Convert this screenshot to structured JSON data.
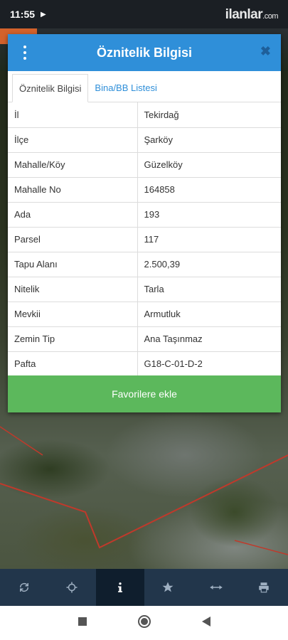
{
  "status": {
    "time": "11:55",
    "watermark": "ilanlar",
    "watermark_suffix": ".com"
  },
  "dialog": {
    "title": "Öznitelik Bilgisi",
    "tabs": [
      {
        "label": "Öznitelik Bilgisi"
      },
      {
        "label": "Bina/BB Listesi"
      }
    ],
    "rows": [
      {
        "key": "İl",
        "value": "Tekirdağ"
      },
      {
        "key": "İlçe",
        "value": "Şarköy"
      },
      {
        "key": "Mahalle/Köy",
        "value": "Güzelköy"
      },
      {
        "key": "Mahalle No",
        "value": "164858"
      },
      {
        "key": "Ada",
        "value": "193"
      },
      {
        "key": "Parsel",
        "value": "117"
      },
      {
        "key": "Tapu Alanı",
        "value": "2.500,39"
      },
      {
        "key": "Nitelik",
        "value": "Tarla"
      },
      {
        "key": "Mevkii",
        "value": "Armutluk"
      },
      {
        "key": "Zemin Tip",
        "value": "Ana Taşınmaz"
      },
      {
        "key": "Pafta",
        "value": "G18-C-01-D-2"
      }
    ],
    "favorite_label": "Favorilere ekle",
    "close_icon": "close-icon",
    "menu_icon": "more-vertical-icon"
  },
  "toolbar": {
    "items": [
      "refresh-icon",
      "locate-icon",
      "info-icon",
      "star-icon",
      "measure-icon",
      "print-icon"
    ],
    "active": "info-icon"
  },
  "colors": {
    "header": "#2f8fd9",
    "favorite": "#5cb85c",
    "toolbar": "#22364b"
  }
}
